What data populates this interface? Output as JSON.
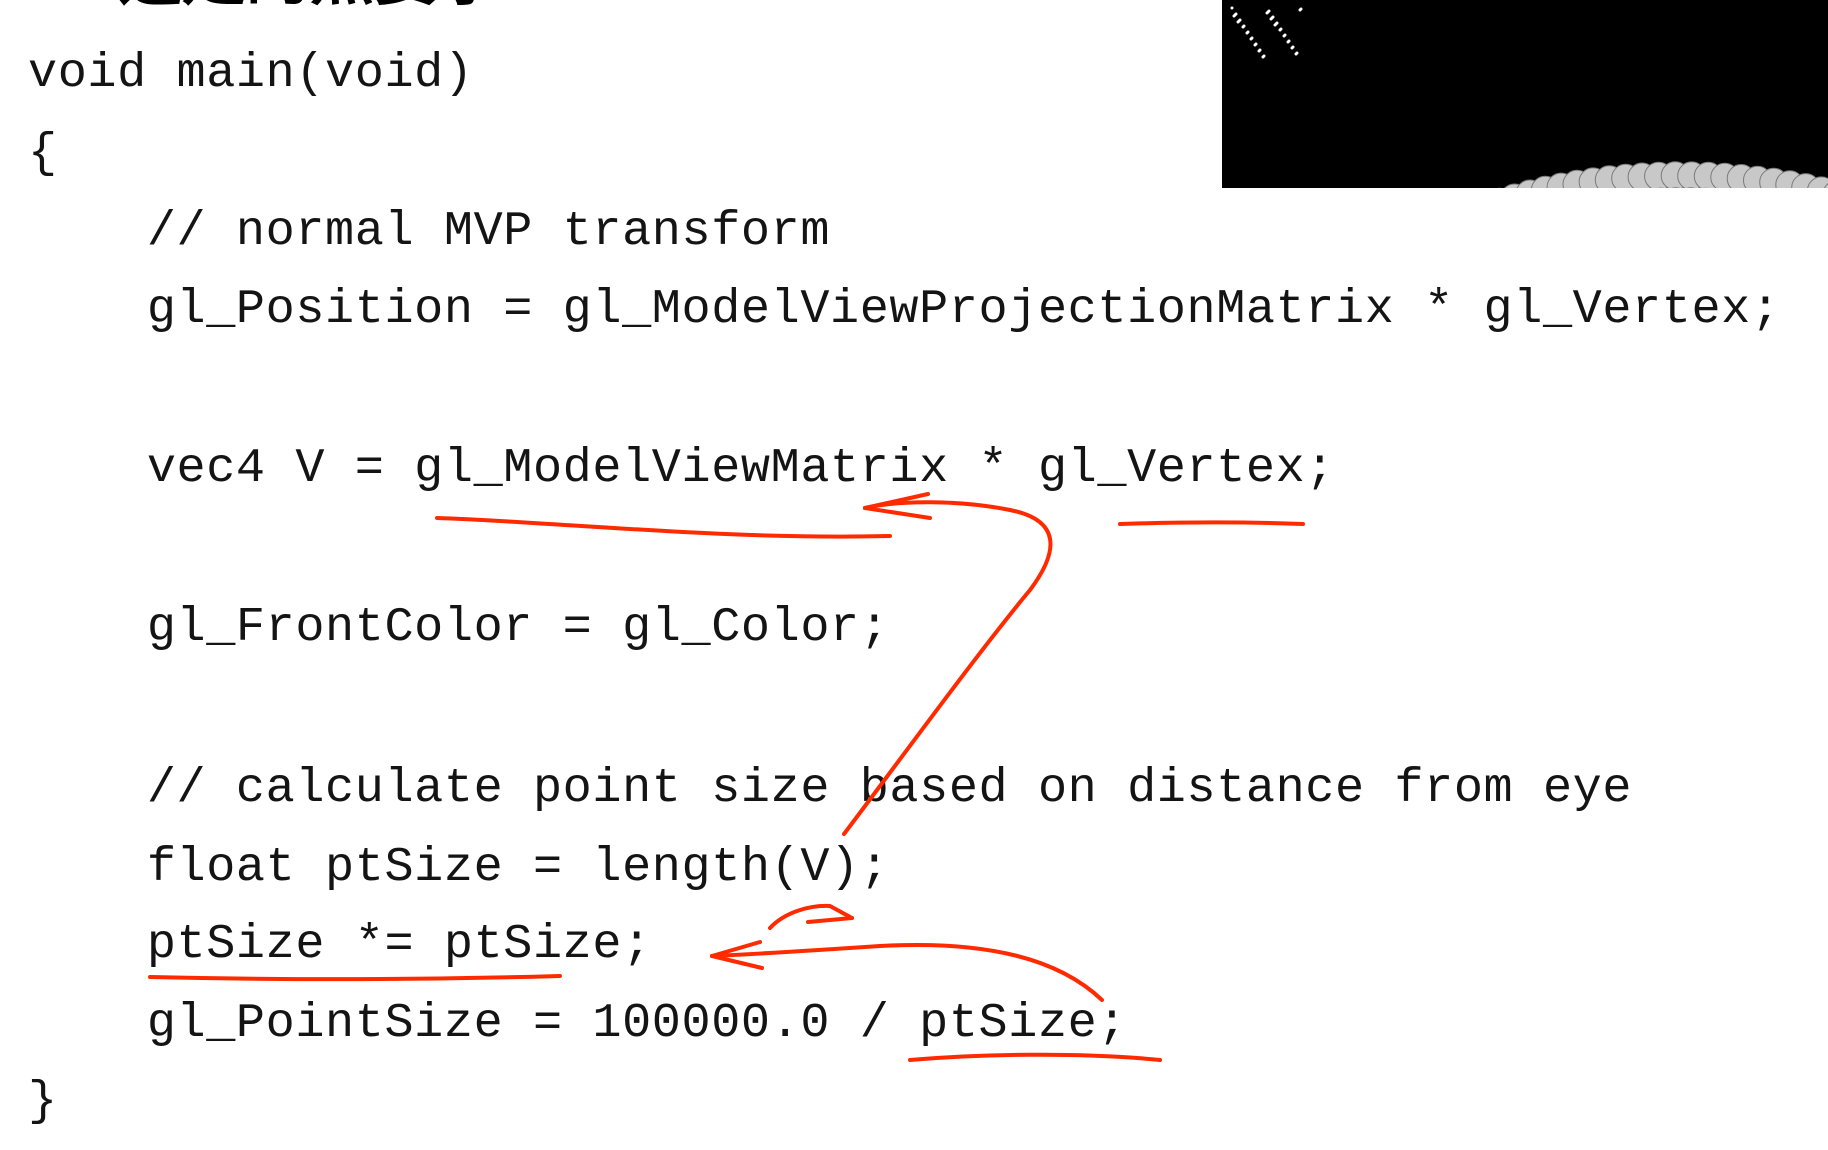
{
  "slide": {
    "heading": "选定的点要予"
  },
  "code": {
    "lines": [
      "void main(void)",
      "{",
      "    // normal MVP transform",
      "    gl_Position = gl_ModelViewProjectionMatrix * gl_Vertex;",
      "",
      "    vec4 V = gl_ModelViewMatrix * gl_Vertex;",
      "",
      "    gl_FrontColor = gl_Color;",
      "",
      "    // calculate point size based on distance from eye",
      "    float ptSize = length(V);",
      "    ptSize *= ptSize;",
      "    gl_PointSize = 100000.0 / ptSize;",
      "}"
    ]
  },
  "thumbnail": {
    "description_icon": "point-sprite-sphere-image",
    "background": "#000000",
    "dot_color": "#c8c8c8"
  },
  "colors": {
    "code_text": "#141414",
    "annotation": "#ff2a00"
  }
}
